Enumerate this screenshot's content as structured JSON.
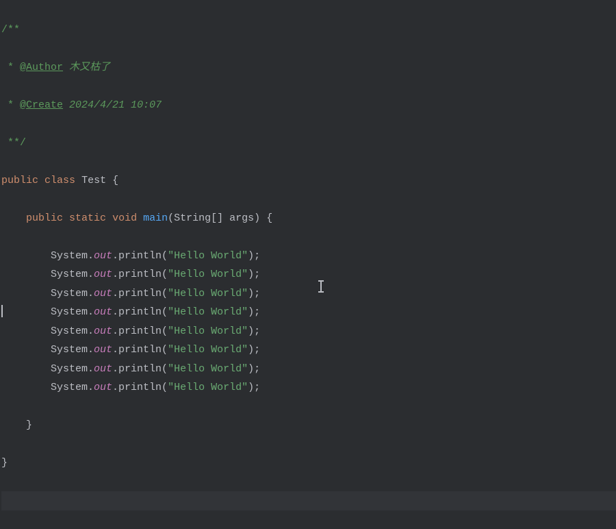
{
  "code": {
    "comment_open": "/**",
    "author_marker": " * ",
    "author_tag": "@Author",
    "author_space": " ",
    "author_name": "木又枯了",
    "create_marker": " * ",
    "create_tag": "@Create",
    "create_space": " ",
    "create_text": "2024/4/21 10:07",
    "comment_close": " **/",
    "class_kw_public": "public",
    "class_kw_class": "class",
    "class_name": "Test",
    "class_brace_open": " {",
    "main_indent": "    ",
    "main_kw_public": "public",
    "main_kw_static": "static",
    "main_kw_void": "void",
    "main_name": "main",
    "main_params_open": "(",
    "main_param_type": "String[] args",
    "main_params_close": ")",
    "main_brace_open": " {",
    "println_indent": "        ",
    "println_system": "System.",
    "println_out": "out",
    "println_method": ".println(",
    "println_string": "\"Hello World\"",
    "println_close": ");",
    "main_brace_close_indent": "    ",
    "main_brace_close": "}",
    "class_brace_close": "}",
    "println_count": 8
  }
}
